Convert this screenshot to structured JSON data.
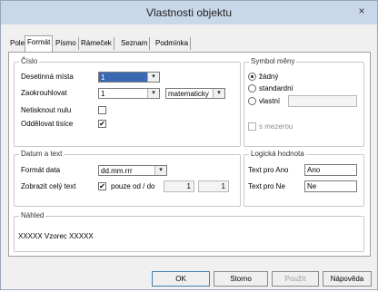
{
  "window": {
    "title": "Vlastnosti objektu",
    "close_glyph": "×"
  },
  "tabs": [
    {
      "label": "Pole"
    },
    {
      "label": "Formát"
    },
    {
      "label": "Písmo"
    },
    {
      "label": "Rámeček"
    },
    {
      "label": "Seznam"
    },
    {
      "label": "Podmínka"
    }
  ],
  "cislo": {
    "title": "Číslo",
    "decimal_label": "Desetinná místa",
    "decimal_value": "1",
    "round_label": "Zaokrouhlovat",
    "round_value": "1",
    "round_mode": "matematicky",
    "suppress_zero_label": "Netisknout nulu",
    "thousands_label": "Oddělovat tisíce"
  },
  "symbol": {
    "title": "Symbol měny",
    "none_label": "žádný",
    "standard_label": "standardní",
    "custom_label": "vlastní",
    "custom_value": "",
    "space_label": "s mezerou"
  },
  "datum": {
    "title": "Datum a text",
    "format_label": "Formát data",
    "format_value": "dd.mm.rrr",
    "fulltext_label": "Zobrazit celý text",
    "only_label": "pouze od / do",
    "from_value": "1",
    "to_value": "1"
  },
  "logic": {
    "title": "Logická hodnota",
    "yes_label": "Text pro Ano",
    "yes_value": "Ano",
    "no_label": "Text pro Ne",
    "no_value": "Ne"
  },
  "preview": {
    "title": "Náhled",
    "text": "XXXXX Vzorec XXXXX"
  },
  "buttons": {
    "ok": "OK",
    "cancel": "Storno",
    "apply": "Použít",
    "help": "Nápověda"
  },
  "icons": {
    "check": "✔",
    "dropdown": "▾"
  }
}
